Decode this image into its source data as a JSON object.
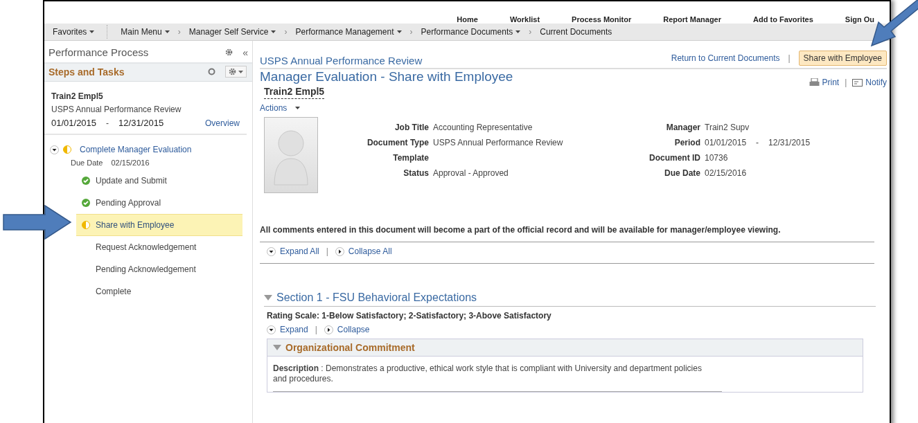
{
  "header_links": [
    "Home",
    "Worklist",
    "Process Monitor",
    "Report Manager",
    "Add to Favorites",
    "Sign Ou"
  ],
  "nav": [
    {
      "label": "Favorites",
      "dropdown": true
    },
    {
      "label": "Main Menu",
      "dropdown": true
    },
    {
      "separator": "›",
      "label": "Manager Self Service",
      "dropdown": true
    },
    {
      "separator": "›",
      "label": "Performance Management",
      "dropdown": true
    },
    {
      "separator": "›",
      "label": "Performance Documents",
      "dropdown": true
    },
    {
      "separator": "›",
      "label": "Current Documents",
      "dropdown": false
    }
  ],
  "sidebar": {
    "title": "Performance Process",
    "collapse_icon": "«",
    "section_title": "Steps and Tasks",
    "employee": "Train2 Empl5",
    "document": "USPS Annual Performance Review",
    "period_start": "01/01/2015",
    "period_sep": "-",
    "period_end": "12/31/2015",
    "overview_link": "Overview",
    "steps": [
      {
        "label": "Complete Manager Evaluation",
        "kind": "in_progress",
        "expanded": true,
        "due_label": "Due Date",
        "due_date": "02/15/2016",
        "selected": false,
        "children": [
          {
            "label": "Update and Submit",
            "kind": "done",
            "selected": false
          },
          {
            "label": "Pending Approval",
            "kind": "done",
            "selected": false
          },
          {
            "label": "Share with Employee",
            "kind": "in_progress",
            "selected": true
          },
          {
            "label": "Request Acknowledgement",
            "kind": "pending",
            "selected": false
          },
          {
            "label": "Pending Acknowledgement",
            "kind": "pending",
            "selected": false
          },
          {
            "label": "Complete",
            "kind": "pending",
            "selected": false
          }
        ]
      }
    ]
  },
  "main": {
    "doc_title": "USPS Annual Performance Review",
    "return_link": "Return to Current Documents",
    "return_separator": "|",
    "share_button": "Share with Employee",
    "page_title": "Manager Evaluation - Share with Employee",
    "print_link": "Print",
    "print_separator": "|",
    "notify_link": "Notify",
    "employee": "Train2 Empl5",
    "actions": "Actions",
    "fields_left": [
      {
        "label": "Job Title",
        "value": "Accounting Representative"
      },
      {
        "label": "Document Type",
        "value": "USPS Annual Performance Review"
      },
      {
        "label": "Template"
      },
      {
        "label": "Status",
        "value": "Approval - Approved"
      }
    ],
    "fields_right": [
      {
        "label": "Manager",
        "value": "Train2 Supv"
      },
      {
        "label": "Period",
        "value": "01/01/2015",
        "sep": "-",
        "value2": "12/31/2015"
      },
      {
        "label": "Document ID",
        "value": "10736"
      },
      {
        "label": "Due Date",
        "value": "02/15/2016"
      }
    ],
    "notice": "All comments entered in this document will become a part of the official record and will be available for manager/employee viewing.",
    "expand_all": "Expand All",
    "toggle_separator": "|",
    "collapse_all": "Collapse All",
    "section": {
      "title": "Section 1 - FSU Behavioral Expectations",
      "expanded": true,
      "rating_scale": "Rating Scale: 1-Below Satisfactory; 2-Satisfactory; 3-Above Satisfactory",
      "expand": "Expand",
      "toggle_separator": "|",
      "collapse": "Collapse",
      "items": [
        {
          "title": "Organizational Commitment",
          "expanded": true,
          "description_label": "Description",
          "description": " : Demonstrates a productive, ethical work style that is compliant with University and department policies and procedures."
        }
      ]
    }
  }
}
